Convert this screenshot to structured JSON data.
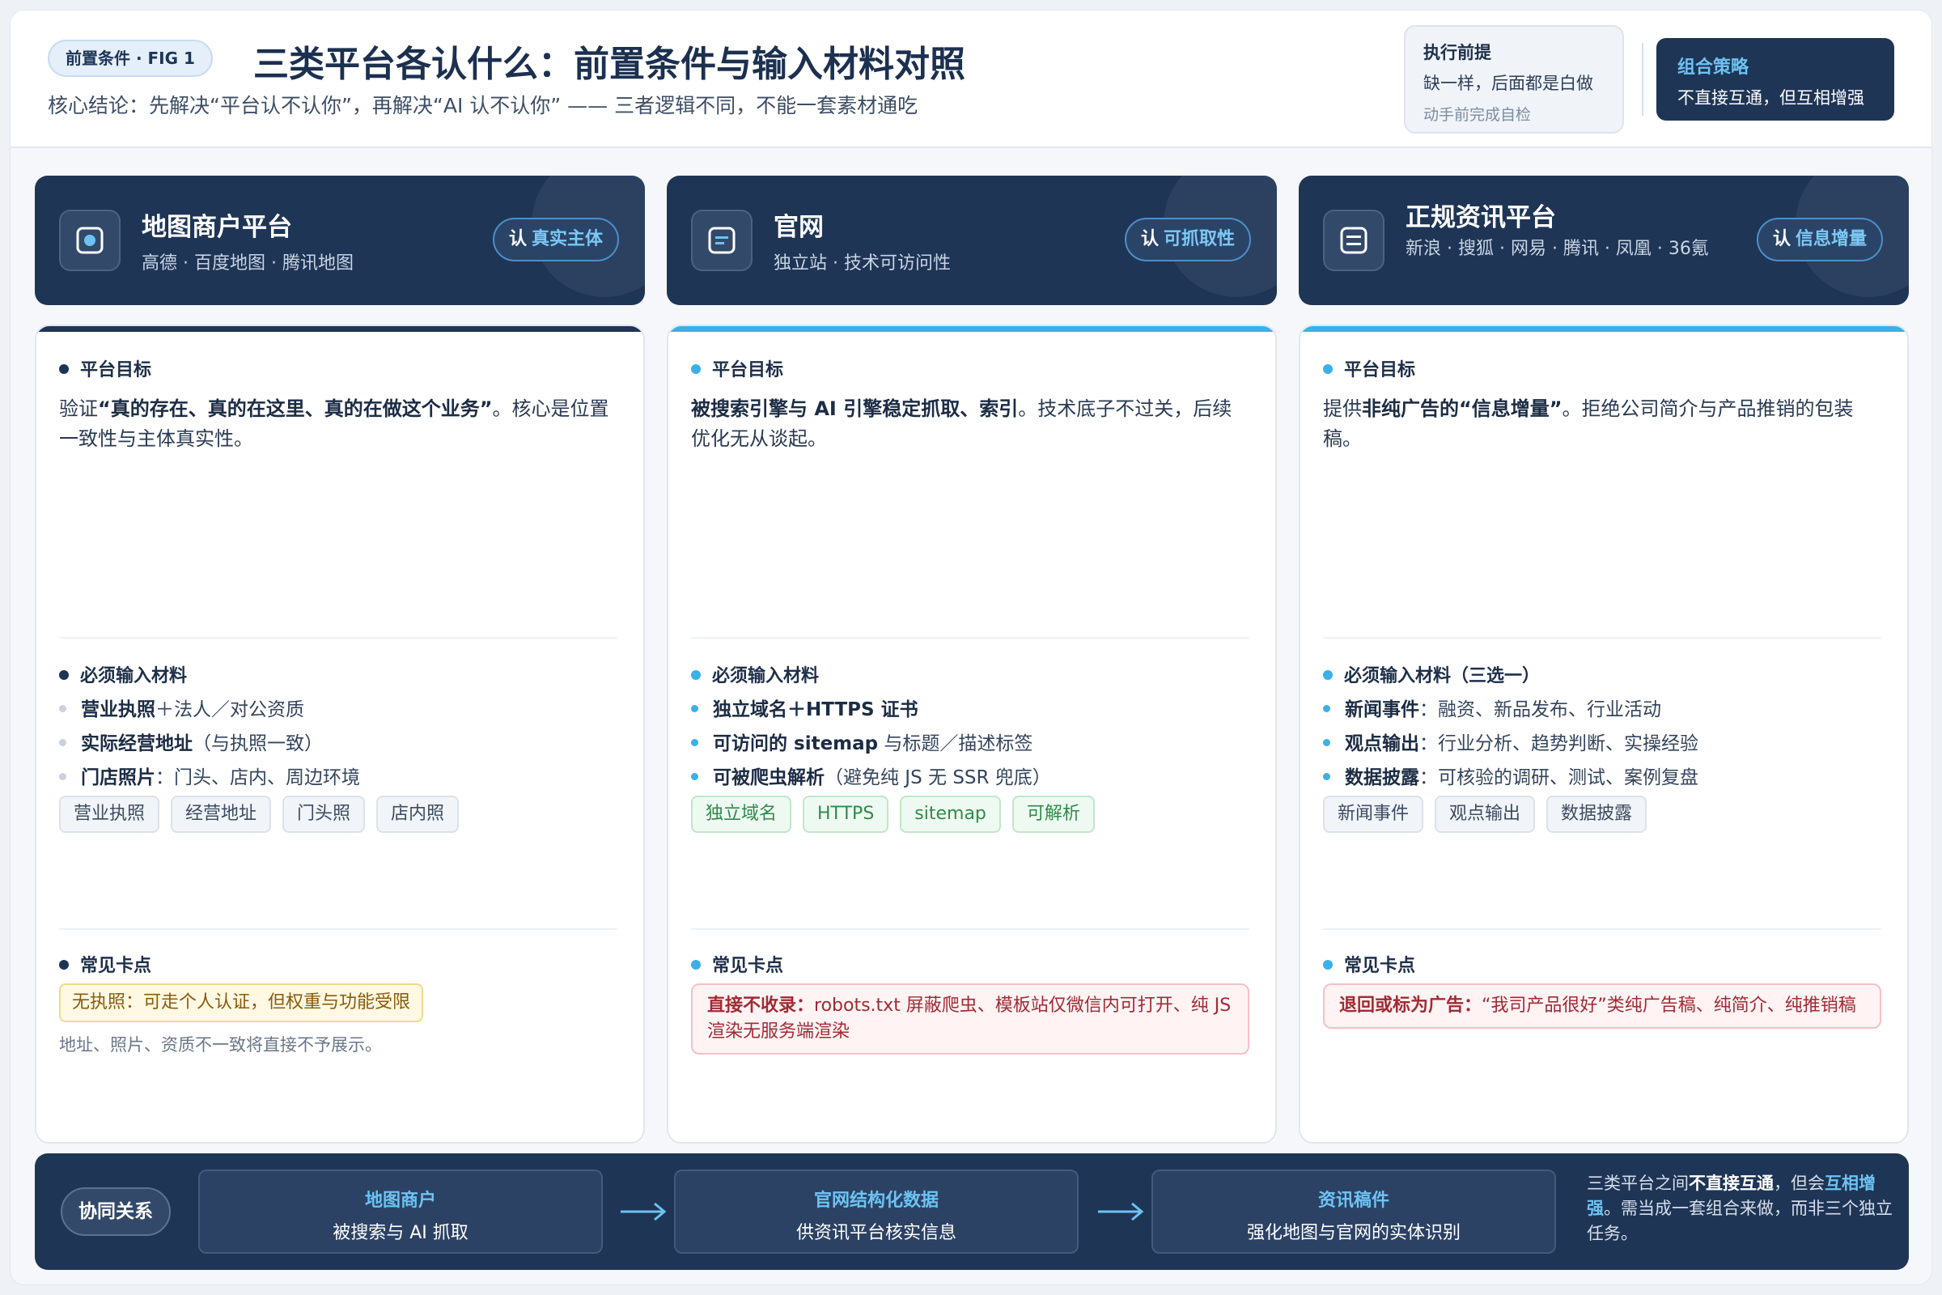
{
  "header": {
    "fig_badge": "前置条件 · FIG 1",
    "title": "三类平台各认什么：前置条件与输入材料对照",
    "subtitle": "核心结论：先解决“平台认不认你”，再解决“AI 认不认你” —— 三者逻辑不同，不能一套素材通吃",
    "exec": {
      "title": "执行前提",
      "line": "缺一样，后面都是白做",
      "note": "动手前完成自检"
    },
    "combo": {
      "title": "组合策略",
      "line": "不直接互通，但互相增强"
    }
  },
  "columns": [
    {
      "title": "地图商户平台",
      "subtitle": "高德 · 百度地图 · 腾讯地图",
      "pill_key": "认",
      "pill_value": "真实主体",
      "icon": "location-target-icon",
      "accent": "#1f3556",
      "goal_label": "平台目标",
      "goal_pre": "验证",
      "goal_bold": "“真的存在、真的在这里、真的在做这个业务”",
      "goal_post": "。核心是位置一致性与主体真实性。",
      "materials_label": "必须输入材料",
      "materials": [
        {
          "bold": "营业执照",
          "rest": "＋法人／对公资质"
        },
        {
          "bold": "实际经营地址",
          "rest": "（与执照一致）"
        },
        {
          "bold": "门店照片",
          "rest": "：门头、店内、周边环境"
        }
      ],
      "tags": [
        "营业执照",
        "经营地址",
        "门头照",
        "店内照"
      ],
      "issues_label": "常见卡点",
      "issue_highlight": "无执照：可走个人认证，但权重与功能受限",
      "issue_note": "地址、照片、资质不一致将直接不予展示。"
    },
    {
      "title": "官网",
      "subtitle": "独立站 · 技术可访问性",
      "pill_key": "认",
      "pill_value": "可抓取性",
      "icon": "webpage-icon",
      "accent": "#3ab0ea",
      "goal_label": "平台目标",
      "goal_pre": "",
      "goal_bold": "被搜索引擎与 AI 引擎稳定抓取、索引",
      "goal_post": "。技术底子不过关，后续优化无从谈起。",
      "materials_label": "必须输入材料",
      "materials": [
        {
          "bold": "独立域名＋HTTPS 证书",
          "rest": ""
        },
        {
          "bold": "可访问的 sitemap",
          "rest": " 与标题／描述标签"
        },
        {
          "bold": "可被爬虫解析",
          "rest": "（避免纯 JS 无 SSR 兜底）"
        }
      ],
      "tags": [
        "独立域名",
        "HTTPS",
        "sitemap",
        "可解析"
      ],
      "issues_label": "常见卡点",
      "issue_bold": "直接不收录：",
      "issue_text": "robots.txt 屏蔽爬虫、模板站仅微信内可打开、纯 JS 渲染无服务端渲染"
    },
    {
      "title": "正规资讯平台",
      "subtitle": "新浪 · 搜狐 · 网易 · 腾讯 · 凤凰 · 36氪",
      "pill_key": "认",
      "pill_value": "信息增量",
      "icon": "article-icon",
      "accent": "#3ab0ea",
      "goal_label": "平台目标",
      "goal_pre": "提供",
      "goal_bold": "非纯广告的“信息增量”",
      "goal_post": "。拒绝公司简介与产品推销的包装稿。",
      "materials_label": "必须输入材料（三选一）",
      "materials": [
        {
          "bold": "新闻事件",
          "rest": "：融资、新品发布、行业活动"
        },
        {
          "bold": "观点输出",
          "rest": "：行业分析、趋势判断、实操经验"
        },
        {
          "bold": "数据披露",
          "rest": "：可核验的调研、测试、案例复盘"
        }
      ],
      "tags": [
        "新闻事件",
        "观点输出",
        "数据披露"
      ],
      "issues_label": "常见卡点",
      "issue_bold": "退回或标为广告：",
      "issue_text": "“我司产品很好”类纯广告稿、纯简介、纯推销稿"
    }
  ],
  "footer": {
    "badge": "协同关系",
    "steps": [
      {
        "title": "地图商户",
        "desc": "被搜索与 AI 抓取"
      },
      {
        "title": "官网结构化数据",
        "desc": "供资讯平台核实信息"
      },
      {
        "title": "资讯稿件",
        "desc": "强化地图与官网的实体识别"
      }
    ],
    "note_pre": "三类平台之间",
    "note_bold": "不直接互通",
    "note_mid": "，但会",
    "note_hl": "互相增强",
    "note_post": "。需当成一套组合来做，而非三个独立任务。"
  }
}
